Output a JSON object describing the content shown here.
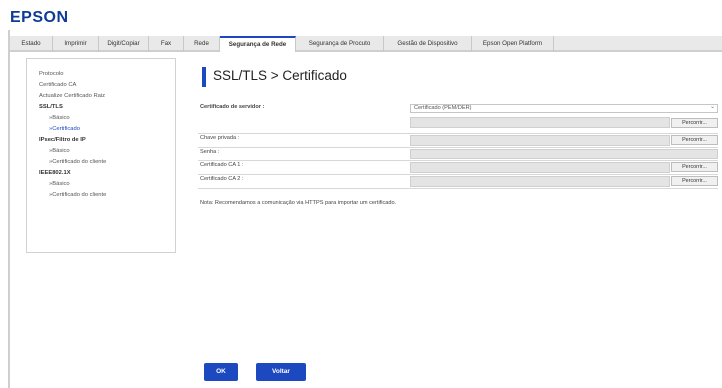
{
  "brand": {
    "logo": "EPSON"
  },
  "tabs": [
    {
      "label": "Estado",
      "active": false
    },
    {
      "label": "Imprimir",
      "active": false
    },
    {
      "label": "Digit/Copiar",
      "active": false
    },
    {
      "label": "Fax",
      "active": false
    },
    {
      "label": "Rede",
      "active": false
    },
    {
      "label": "Segurança de Rede",
      "active": true
    },
    {
      "label": "Segurança de Procuto",
      "active": false
    },
    {
      "label": "Gestão de Dispositivo",
      "active": false
    },
    {
      "label": "Epson Open Platform",
      "active": false
    }
  ],
  "sidebar": {
    "items": [
      {
        "label": "Protocolo"
      },
      {
        "label": "Certificado CA"
      },
      {
        "label": "Actualize Certificado Raiz"
      },
      {
        "label": "SSL/TLS"
      },
      {
        "label": "»Básico"
      },
      {
        "label": "»Certificado"
      },
      {
        "label": "IPsec/Filtro de IP"
      },
      {
        "label": "»Básico"
      },
      {
        "label": "»Certificado do cliente"
      },
      {
        "label": "IEEE802.1X"
      },
      {
        "label": "»Básico"
      },
      {
        "label": "»Certificado do cliente"
      }
    ]
  },
  "page": {
    "title": "SSL/TLS > Certificado"
  },
  "form": {
    "server_cert_label": "Certificado de servidor :",
    "server_cert_format": "Certificado (PEM/DER)",
    "private_key_label": "Chave privada :",
    "password_label": "Senha :",
    "ca1_label": "Certificado CA 1 :",
    "ca2_label": "Certificado CA 2 :",
    "browse_label": "Percorrir..."
  },
  "note": "Nota: Recomendamos a comunicação via HTTPS para importar um certificado.",
  "buttons": {
    "ok": "OK",
    "back": "Voltar"
  },
  "colors": {
    "accent": "#1d49c0",
    "logo": "#0d3b96"
  }
}
